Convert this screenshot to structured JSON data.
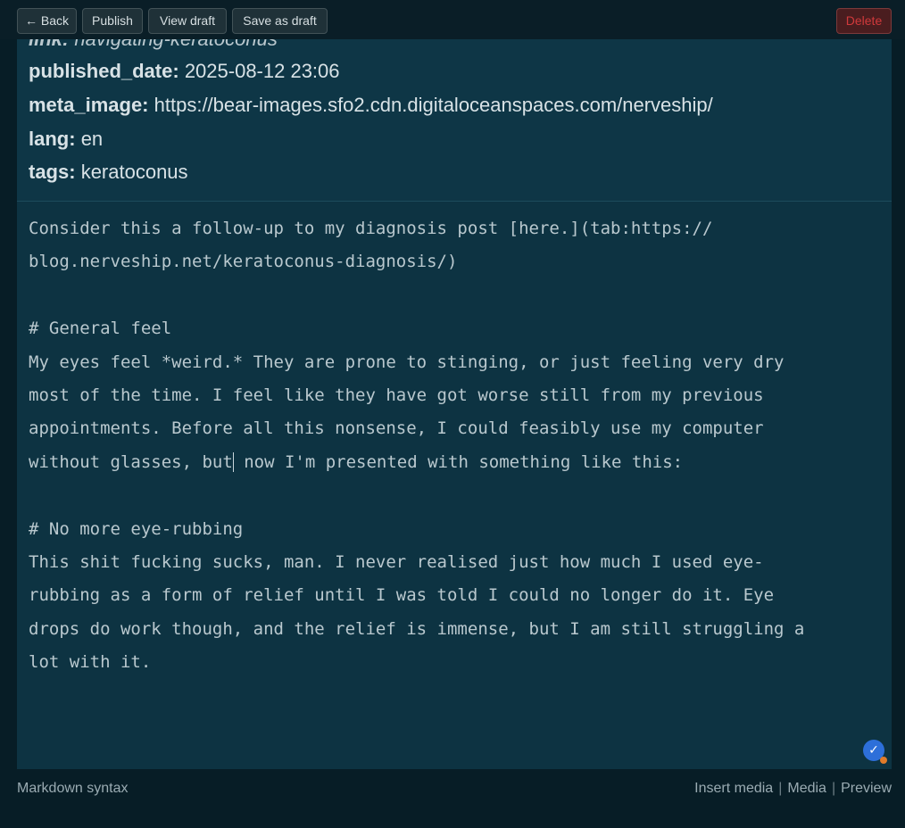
{
  "toolbar": {
    "back": "← Back",
    "publish": "Publish",
    "view_draft": "View draft",
    "save_as_draft": "Save as draft",
    "delete": "Delete"
  },
  "header": {
    "link": {
      "key": "link:",
      "value": "navigating-keratoconus"
    },
    "published_date": {
      "key": "published_date:",
      "value": "2025-08-12 23:06"
    },
    "meta_image": {
      "key": "meta_image:",
      "value": "https://bear-images.sfo2.cdn.digitaloceanspaces.com/nerveship/"
    },
    "lang": {
      "key": "lang:",
      "value": "en"
    },
    "tags": {
      "key": "tags:",
      "value": "keratoconus"
    }
  },
  "body": {
    "lines": [
      "Consider this a follow-up to my diagnosis post [here.](tab:https://",
      "blog.nerveship.net/keratoconus-diagnosis/)",
      "",
      "# General feel",
      "My eyes feel *weird.* They are prone to stinging, or just feeling very dry",
      "most of the time. I feel like they have got worse still from my previous",
      "appointments. Before all this nonsense, I could feasibly use my computer",
      "without glasses, but",
      " now I'm presented with something like this:",
      "",
      "# No more eye-rubbing",
      "This shit fucking sucks, man. I never realised just how much I used eye-",
      "rubbing as a form of relief until I was told I could no longer do it. Eye",
      "drops do work though, and the relief is immense, but I am still struggling a",
      "lot with it."
    ]
  },
  "sync_badge": {
    "icon": "check-icon",
    "glyph": "✓"
  },
  "footer": {
    "markdown_syntax": "Markdown syntax",
    "insert_media": "Insert media",
    "media": "Media",
    "preview": "Preview",
    "separator": "|"
  }
}
